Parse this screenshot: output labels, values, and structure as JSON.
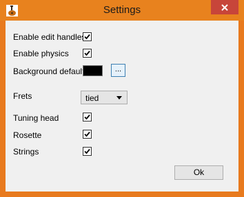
{
  "window": {
    "title": "Settings",
    "icons": {
      "app": "guitar-app-icon",
      "close": "close-icon"
    },
    "colors": {
      "titlebar": "#e8821e",
      "close": "#c7453a",
      "client": "#f0f0f0"
    }
  },
  "settings": {
    "edit_handles": {
      "label": "Enable edit handles",
      "checked": true
    },
    "physics": {
      "label": "Enable physics",
      "checked": true
    },
    "background": {
      "label": "Background default",
      "color": "#000000",
      "browse_label": "..."
    },
    "frets": {
      "label": "Frets",
      "value": "tied"
    },
    "tuning_head": {
      "label": "Tuning head",
      "checked": true
    },
    "rosette": {
      "label": "Rosette",
      "checked": true
    },
    "strings": {
      "label": "Strings",
      "checked": true
    }
  },
  "footer": {
    "ok_label": "Ok"
  }
}
